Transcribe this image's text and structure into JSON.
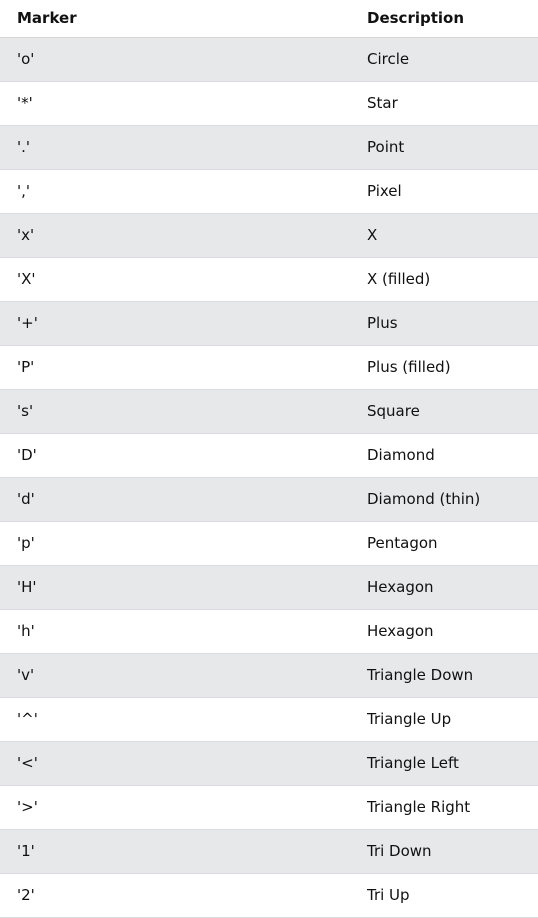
{
  "table": {
    "headers": {
      "marker": "Marker",
      "description": "Description"
    },
    "rows": [
      {
        "marker": "'o'",
        "description": "Circle"
      },
      {
        "marker": "'*'",
        "description": "Star"
      },
      {
        "marker": "'.'",
        "description": "Point"
      },
      {
        "marker": "','",
        "description": "Pixel"
      },
      {
        "marker": "'x'",
        "description": "X"
      },
      {
        "marker": "'X'",
        "description": "X (filled)"
      },
      {
        "marker": "'+'",
        "description": "Plus"
      },
      {
        "marker": "'P'",
        "description": "Plus (filled)"
      },
      {
        "marker": "'s'",
        "description": "Square"
      },
      {
        "marker": "'D'",
        "description": "Diamond"
      },
      {
        "marker": "'d'",
        "description": "Diamond (thin)"
      },
      {
        "marker": "'p'",
        "description": "Pentagon"
      },
      {
        "marker": "'H'",
        "description": "Hexagon"
      },
      {
        "marker": "'h'",
        "description": "Hexagon"
      },
      {
        "marker": "'v'",
        "description": "Triangle Down"
      },
      {
        "marker": "'^'",
        "description": "Triangle Up"
      },
      {
        "marker": "'<'",
        "description": "Triangle Left"
      },
      {
        "marker": "'>'",
        "description": "Triangle Right"
      },
      {
        "marker": "'1'",
        "description": "Tri Down"
      },
      {
        "marker": "'2'",
        "description": "Tri Up"
      }
    ]
  }
}
